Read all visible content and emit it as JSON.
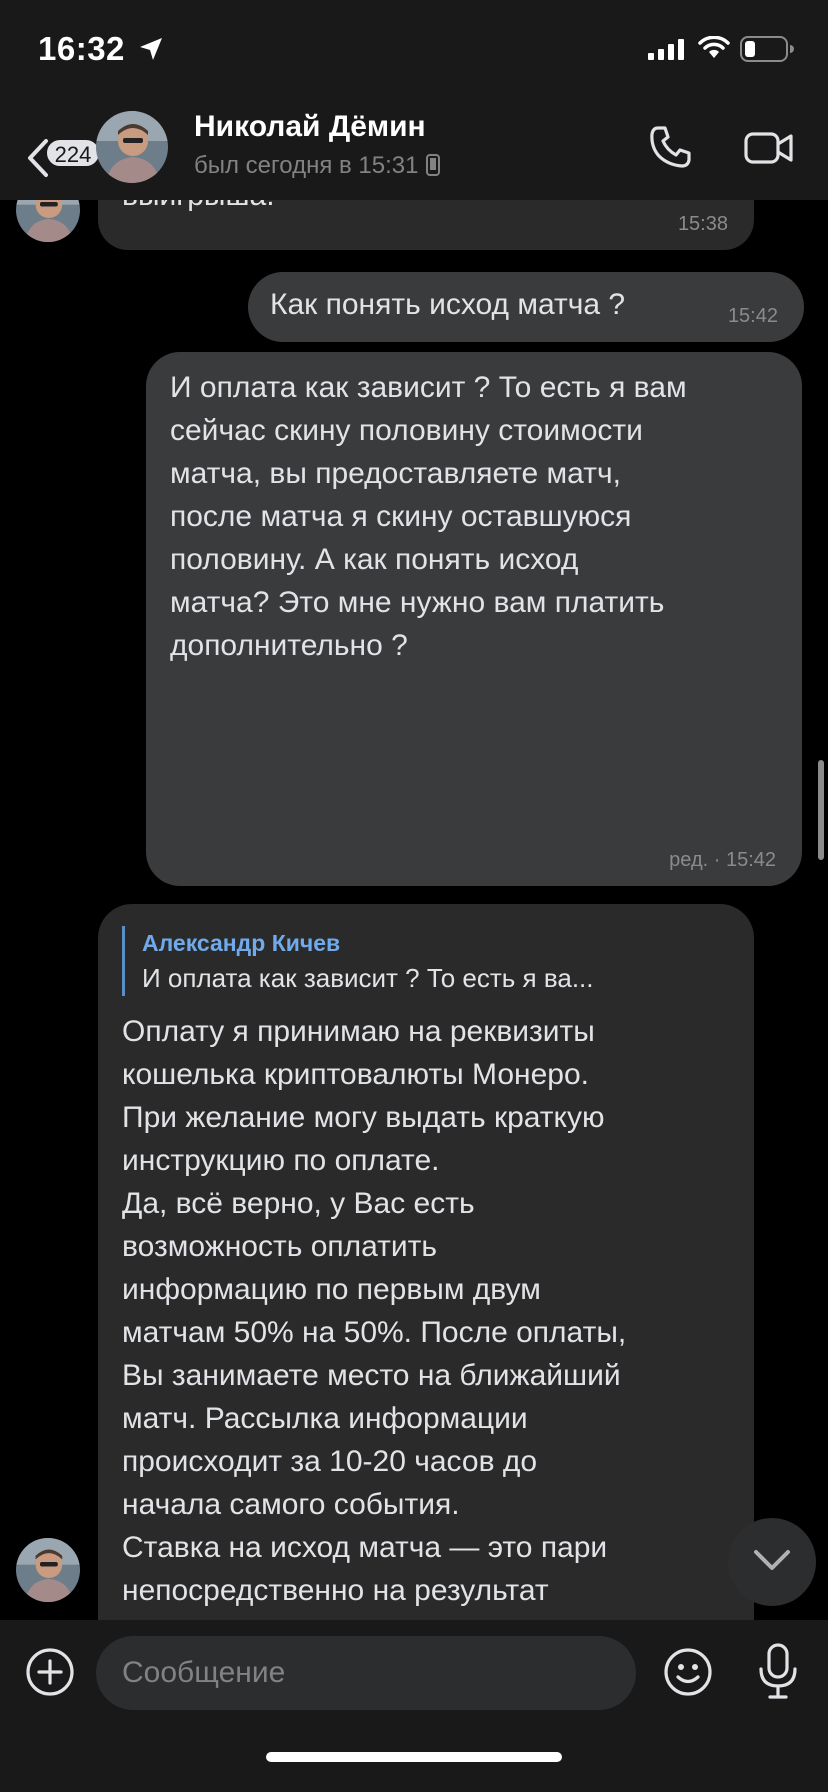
{
  "status_bar": {
    "time": "16:32"
  },
  "header": {
    "back_badge": "224",
    "contact_name": "Николай Дёмин",
    "last_seen": "был сегодня в 15:31"
  },
  "messages": [
    {
      "direction": "incoming",
      "text": "выигрыша.",
      "time": "15:38"
    },
    {
      "direction": "outgoing",
      "text": "Как понять исход матча ?",
      "time": "15:42"
    },
    {
      "direction": "outgoing",
      "text": "И оплата как зависит ? То есть я вам\nсейчас скину половину стоимости\nматча, вы предоставляете матч,\nпосле матча я скину оставшуюся\nполовину. А как понять исход\nматча? Это мне нужно вам платить\nдополнительно ?",
      "time": "ред. · 15:42"
    },
    {
      "direction": "incoming",
      "reply_author": "Александр Кичев",
      "reply_text": "И оплата как зависит ? То есть я ва...",
      "text": "Оплату я принимаю на реквизиты\nкошелька криптовалюты Монеро.\nПри желание могу выдать краткую\nинструкцию по оплате.\nДа, всё верно, у Вас есть\nвозможность оплатить\nинформацию по первым двум\nматчам 50% на 50%. После оплаты,\nВы занимаете место на ближайший\nматч. Рассылка информации\nпроисходит за 10-20 часов до\nначала самого события.\nСтавка на исход матча — это пари\nнепосредственно на результат\n(победу определённой команды).\nРекомендую покупать \"Исход\"\nпосле нескольких ставок на Точный\nсчёт, для отвода глаз БК. На нём Вы"
    }
  ],
  "composer": {
    "placeholder": "Сообщение"
  },
  "colors": {
    "background": "#000000",
    "bar": "#191919",
    "incoming_bubble": "#2a2a2b",
    "outgoing_bubble": "#3a3b3d",
    "accent": "#71aaeb"
  },
  "icons": {
    "location": "location-arrow-icon",
    "signal": "signal-bars-icon",
    "wifi": "wifi-icon",
    "battery": "battery-icon",
    "back": "chevron-left-icon",
    "phone": "phone-icon",
    "video": "video-camera-icon",
    "add": "plus-circle-icon",
    "emoji": "smile-icon",
    "mic": "microphone-icon",
    "scroll_down": "chevron-down-icon"
  }
}
